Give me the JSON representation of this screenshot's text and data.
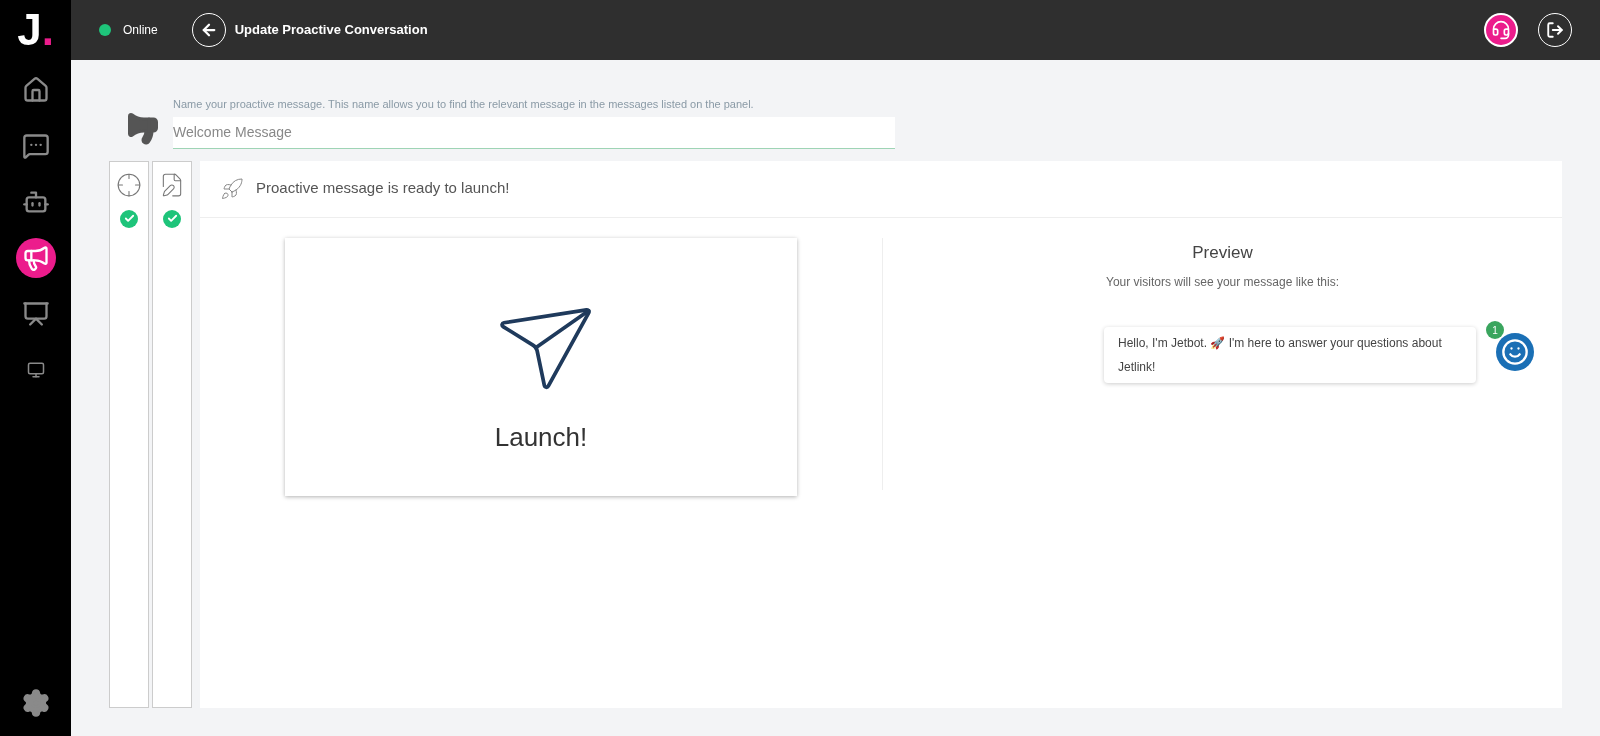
{
  "logo": {
    "letter": "J",
    "dot": "."
  },
  "sidebar": {
    "items": [
      {
        "selected": false
      },
      {
        "selected": false
      },
      {
        "selected": false
      },
      {
        "selected": true
      },
      {
        "selected": false
      },
      {
        "selected": false
      }
    ]
  },
  "header": {
    "status": {
      "label": "Online",
      "online": true
    },
    "title": "Update Proactive Conversation"
  },
  "name_section": {
    "hint": "Name your proactive message. This name allows you to find the relevant message in the messages listed on the panel.",
    "value": "Welcome Message"
  },
  "steps": [
    {
      "completed": true
    },
    {
      "completed": true
    }
  ],
  "panel": {
    "heading": "Proactive message is ready to launch!",
    "launch_label": "Launch!",
    "preview": {
      "title": "Preview",
      "subtitle": "Your visitors will see your message like this:",
      "message": "Hello, I'm Jetbot. 🚀 I'm here to answer your questions about Jetlink!",
      "badge": "1"
    }
  }
}
